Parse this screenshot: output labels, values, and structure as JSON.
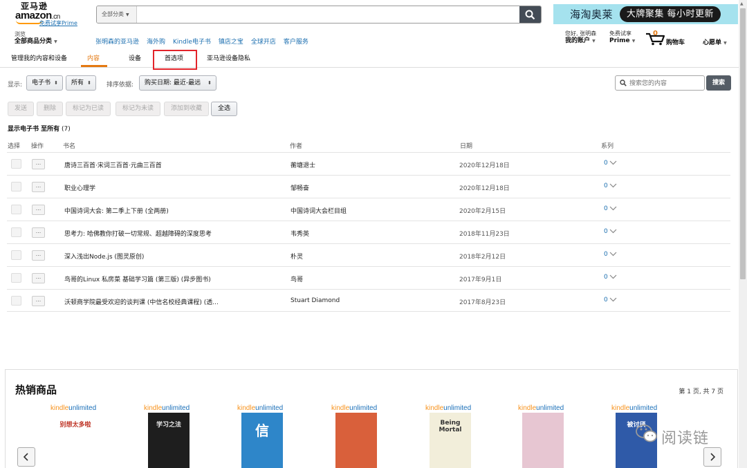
{
  "header": {
    "logo_cn": "亚马逊",
    "logo_en": "amazon",
    "logo_en_suffix": ".cn",
    "prime_link": "免费试享Prime",
    "search_category": "全部分类",
    "search_placeholder": "",
    "banner_left": "海淘奥莱",
    "banner_right": "大牌聚集 每小时更新",
    "browse_line1": "浏览",
    "browse_line2": "全部商品分类",
    "nav_links": [
      "张明森的亚马逊",
      "海外购",
      "Kindle电子书",
      "镇店之宝",
      "全球开店",
      "客户服务"
    ],
    "account_line1": "您好, 张明森",
    "account_line2": "我的账户",
    "prime_line1": "免费试享",
    "prime_line2": "Prime",
    "cart_count": "0",
    "cart_label": "购物车",
    "wishlist": "心愿单"
  },
  "subnav": {
    "title": "管理我的内容和设备",
    "tabs": [
      "内容",
      "设备",
      "首选项",
      "亚马逊设备隐私"
    ],
    "active_tab": "内容",
    "highlighted_tab": "首选项"
  },
  "filters": {
    "show_label": "显示:",
    "type_value": "电子书",
    "scope_value": "所有",
    "sort_label": "排序依据:",
    "sort_value": "购买日期: 最近-最远",
    "search_placeholder": "搜索您的内容",
    "search_button": "搜索"
  },
  "actions": {
    "send": "发送",
    "delete": "删除",
    "mark_read": "标记为已读",
    "mark_unread": "标记为未读",
    "add_collection": "添加到收藏",
    "select_all": "全选"
  },
  "summary": {
    "prefix": "显示电子书 至所有",
    "count": "(7)"
  },
  "table": {
    "headers": {
      "select": "选择",
      "action": "操作",
      "title": "书名",
      "author": "作者",
      "date": "日期",
      "series": "系列"
    },
    "rows": [
      {
        "title": "唐诗三百首·宋词三百首·元曲三百首",
        "author": "蘅塘退士",
        "date": "2020年12月18日",
        "series": "0"
      },
      {
        "title": "职业心理学",
        "author": "邹畅奋",
        "date": "2020年12月18日",
        "series": "0"
      },
      {
        "title": "中国诗词大会: 第二季上下册 (全两册)",
        "author": "中国诗词大会栏目组",
        "date": "2020年2月15日",
        "series": "0"
      },
      {
        "title": "思考力: 哈佛教你打破一切常规、超越障碍的深度思考",
        "author": "韦秀英",
        "date": "2018年11月23日",
        "series": "0"
      },
      {
        "title": "深入浅出Node.js (图灵原创)",
        "author": "朴灵",
        "date": "2018年2月12日",
        "series": "0"
      },
      {
        "title": "鸟哥的Linux 私房菜 基础学习篇 (第三版) (异步图书)",
        "author": "鸟哥",
        "date": "2017年9月1日",
        "series": "0"
      },
      {
        "title": "沃顿商学院最受欢迎的谈判课 (中信名校经典课程) (透...",
        "author": "Stuart Diamond",
        "date": "2017年8月23日",
        "series": "0"
      }
    ]
  },
  "bestsellers": {
    "heading": "热销商品",
    "pagination": "第 1 页, 共 7 页",
    "badge_k": "kindle",
    "badge_u": "unlimited",
    "covers": [
      {
        "text": "别想太多啦",
        "bg": "#ffffff",
        "fg": "#c0392b"
      },
      {
        "text": "学习之法",
        "bg": "#1e1e1e",
        "fg": "#e8e8e8"
      },
      {
        "text": "信",
        "bg": "#2e86c9",
        "fg": "#ffffff"
      },
      {
        "text": "",
        "bg": "#d9603b",
        "fg": "#ffffff"
      },
      {
        "text": "Being Mortal",
        "bg": "#f2eeda",
        "fg": "#333333"
      },
      {
        "text": "",
        "bg": "#e7c6d2",
        "fg": "#333333"
      },
      {
        "text": "被讨厌",
        "bg": "#2f5aa8",
        "fg": "#ffffff"
      }
    ]
  },
  "watermark": "阅读链"
}
